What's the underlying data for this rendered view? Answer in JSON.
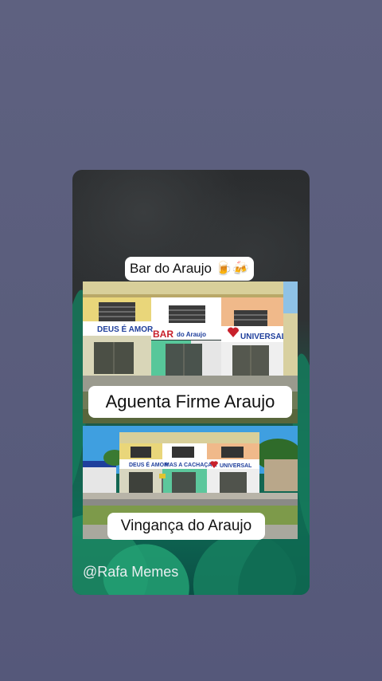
{
  "post": {
    "top_label": "Bar do Araujo 🍺🍻",
    "caption_top": "Aguenta Firme Araujo",
    "caption_bottom": "Vingança do Araujo",
    "watermark": "@Rafa Memes"
  },
  "photo_top": {
    "sign_left": "DEUS É AMOR",
    "sign_middle_bar": "BAR",
    "sign_middle_rest": "do Araujo",
    "sign_right": "UNIVERSAL"
  },
  "photo_bottom": {
    "sign_left": "DEUS É AMOR",
    "sign_middle": "MAS A CACHAÇA É",
    "sign_right": "UNIVERSAL"
  },
  "colors": {
    "background": "#5a5d7c",
    "caption_bg": "#ffffff",
    "caption_text": "#111111",
    "sign_blue": "#1f3f9c",
    "sign_red": "#c8202b"
  }
}
